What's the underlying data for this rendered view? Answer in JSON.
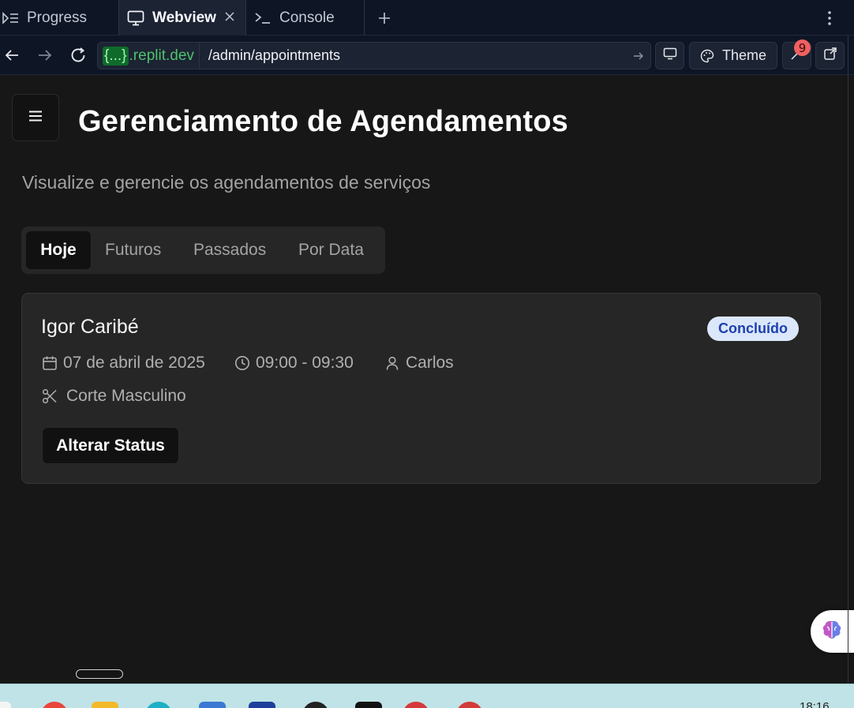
{
  "ide_tabs": [
    {
      "label": "Progress",
      "icon": "progress-icon"
    },
    {
      "label": "Webview",
      "icon": "monitor-icon",
      "active": true
    },
    {
      "label": "Console",
      "icon": "terminal-icon"
    }
  ],
  "address": {
    "host_braces": "{...}",
    "host": ".replit.dev",
    "path": "/admin/appointments"
  },
  "toolbar": {
    "theme_label": "Theme",
    "devtools_badge": "9"
  },
  "page": {
    "title": "Gerenciamento de Agendamentos",
    "subtitle": "Visualize e gerencie os agendamentos de serviços",
    "tabs": [
      "Hoje",
      "Futuros",
      "Passados",
      "Por Data"
    ],
    "active_tab": "Hoje"
  },
  "appointment": {
    "client": "Igor Caribé",
    "status": "Concluído",
    "date": "07 de abril de 2025",
    "time": "09:00 - 09:30",
    "professional": "Carlos",
    "service": "Corte Masculino",
    "action_label": "Alterar Status"
  },
  "taskbar": {
    "clock": "18:16"
  },
  "colors": {
    "status_bg": "#dbe8fb",
    "status_text": "#1e40af",
    "url_host": "#4ec36b",
    "badge": "#f06060"
  }
}
